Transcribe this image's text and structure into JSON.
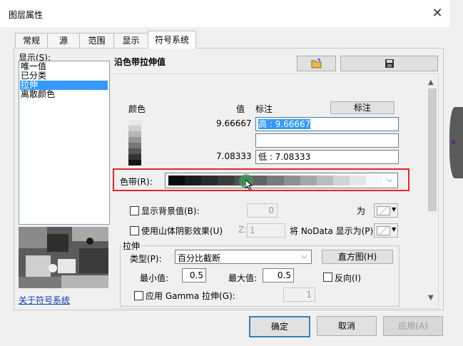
{
  "window": {
    "title": "图层属性",
    "close_glyph": "✕"
  },
  "tabs": [
    {
      "label": "常规"
    },
    {
      "label": "源"
    },
    {
      "label": "范围"
    },
    {
      "label": "显示"
    },
    {
      "label": "符号系统",
      "active": true
    }
  ],
  "sidebar": {
    "show_label": "显示(S):",
    "items": [
      {
        "label": "唯一值",
        "selected": false
      },
      {
        "label": "已分类",
        "selected": false
      },
      {
        "label": "拉伸",
        "selected": true
      },
      {
        "label": "离散颜色",
        "selected": false
      }
    ],
    "about_link": "关于符号系统"
  },
  "panel": {
    "title": "沿色带拉伸值",
    "open_icon": "folder-open-icon",
    "save_icon": "save-icon",
    "color_header": "颜色",
    "value_header": "值",
    "label_header": "标注",
    "label_button": "标注",
    "high_value": "9.66667",
    "high_label": "高 : 9.66667",
    "mid_label": "",
    "low_value": "7.08333",
    "low_label": "低 : 7.08333",
    "color_ramp_label": "色带(R):",
    "show_background_label": "显示背景值(B):",
    "background_value": "0",
    "as_label": "为",
    "hillshade_label": "使用山体阴影效果(U)",
    "z_label": "Z:",
    "z_value": "1",
    "nodata_label": "将 NoData 显示为(P)",
    "stretch_group": "拉伸",
    "type_label": "类型(P):",
    "type_value": "百分比截断",
    "histogram_button": "直方图(H)",
    "min_label": "最小值:",
    "min_value": "0.5",
    "max_label": "最大值:",
    "max_value": "0.5",
    "invert_label": "反向(I)",
    "gamma_label": "应用 Gamma 拉伸(G):",
    "gamma_value": "1",
    "ramp_colors": [
      "#0a0a0a",
      "#1c1c1c",
      "#2c2c2c",
      "#3c3c3c",
      "#505050",
      "#646464",
      "#7a7a7a",
      "#909090",
      "#a6a6a6",
      "#bcbcbc",
      "#d2d2d2",
      "#e6e6e6",
      "#f6f6f6"
    ],
    "swatch_colors": [
      "#e8e8e8",
      "#cfcfcf",
      "#b4b4b4",
      "#969696",
      "#777777",
      "#565656",
      "#353535",
      "#161616"
    ]
  },
  "buttons": {
    "ok": "确定",
    "cancel": "取消",
    "apply": "应用(A)"
  },
  "colors": {
    "accent_red": "#e8262b",
    "selection": "#3399ff",
    "link": "#0a3fb3"
  }
}
